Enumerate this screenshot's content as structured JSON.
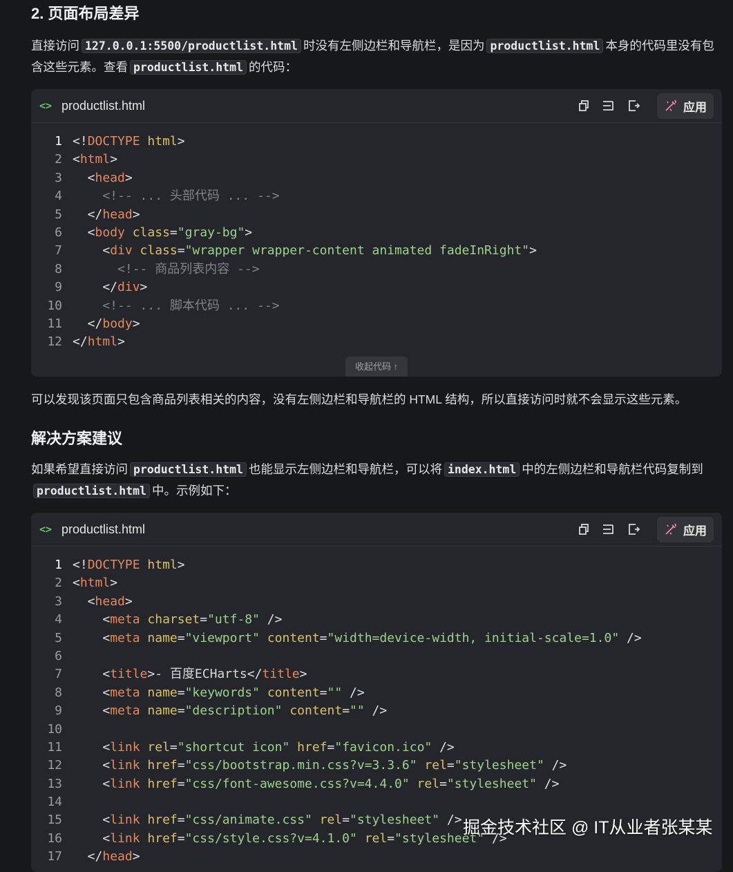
{
  "section_title": "2. 页面布局差异",
  "para1": [
    {
      "t": "text",
      "v": "直接访问"
    },
    {
      "t": "code",
      "v": "127.0.0.1:5500/productlist.html"
    },
    {
      "t": "text",
      "v": "时没有左侧边栏和导航栏，是因为"
    },
    {
      "t": "code",
      "v": "productlist.html"
    },
    {
      "t": "text",
      "v": "本身的代码里没有包含这些元素。查看"
    },
    {
      "t": "code",
      "v": "productlist.html"
    },
    {
      "t": "text",
      "v": "的代码："
    }
  ],
  "block1": {
    "file_icon": "<>",
    "filename": "productlist.html",
    "apply_label": "应用",
    "collapse_label": "收起代码 ↑",
    "lines": [
      [
        [
          "p",
          "<!"
        ],
        [
          "t",
          "DOCTYPE"
        ],
        [
          "p",
          " "
        ],
        [
          "a",
          "html"
        ],
        [
          "p",
          ">"
        ]
      ],
      [
        [
          "p",
          "<"
        ],
        [
          "t",
          "html"
        ],
        [
          "p",
          ">"
        ]
      ],
      [
        [
          "p",
          "  <"
        ],
        [
          "t",
          "head"
        ],
        [
          "p",
          ">"
        ]
      ],
      [
        [
          "cm",
          "    <!-- ... 头部代码 ... -->"
        ]
      ],
      [
        [
          "p",
          "  </"
        ],
        [
          "t",
          "head"
        ],
        [
          "p",
          ">"
        ]
      ],
      [
        [
          "p",
          "  <"
        ],
        [
          "t",
          "body"
        ],
        [
          "p",
          " "
        ],
        [
          "a",
          "class"
        ],
        [
          "p",
          "="
        ],
        [
          "s",
          "\"gray-bg\""
        ],
        [
          "p",
          ">"
        ]
      ],
      [
        [
          "p",
          "    <"
        ],
        [
          "t",
          "div"
        ],
        [
          "p",
          " "
        ],
        [
          "a",
          "class"
        ],
        [
          "p",
          "="
        ],
        [
          "s",
          "\"wrapper wrapper-content animated fadeInRight\""
        ],
        [
          "p",
          ">"
        ]
      ],
      [
        [
          "cm",
          "      <!-- 商品列表内容 -->"
        ]
      ],
      [
        [
          "p",
          "    </"
        ],
        [
          "t",
          "div"
        ],
        [
          "p",
          ">"
        ]
      ],
      [
        [
          "cm",
          "    <!-- ... 脚本代码 ... -->"
        ]
      ],
      [
        [
          "p",
          "  </"
        ],
        [
          "t",
          "body"
        ],
        [
          "p",
          ">"
        ]
      ],
      [
        [
          "p",
          "</"
        ],
        [
          "t",
          "html"
        ],
        [
          "p",
          ">"
        ]
      ]
    ]
  },
  "para2": "可以发现该页面只包含商品列表相关的内容，没有左侧边栏和导航栏的 HTML 结构，所以直接访问时就不会显示这些元素。",
  "section2_title": "解决方案建议",
  "para3": [
    {
      "t": "text",
      "v": "如果希望直接访问"
    },
    {
      "t": "code",
      "v": "productlist.html"
    },
    {
      "t": "text",
      "v": "也能显示左侧边栏和导航栏，可以将"
    },
    {
      "t": "code",
      "v": "index.html"
    },
    {
      "t": "text",
      "v": "中的左侧边栏和导航栏代码复制到"
    },
    {
      "t": "code",
      "v": "productlist.html"
    },
    {
      "t": "text",
      "v": "中。示例如下："
    }
  ],
  "block2": {
    "file_icon": "<>",
    "filename": "productlist.html",
    "apply_label": "应用",
    "lines": [
      [
        [
          "p",
          "<!"
        ],
        [
          "t",
          "DOCTYPE"
        ],
        [
          "p",
          " "
        ],
        [
          "a",
          "html"
        ],
        [
          "p",
          ">"
        ]
      ],
      [
        [
          "p",
          "<"
        ],
        [
          "t",
          "html"
        ],
        [
          "p",
          ">"
        ]
      ],
      [
        [
          "p",
          "  <"
        ],
        [
          "t",
          "head"
        ],
        [
          "p",
          ">"
        ]
      ],
      [
        [
          "p",
          "    <"
        ],
        [
          "t",
          "meta"
        ],
        [
          "p",
          " "
        ],
        [
          "a",
          "charset"
        ],
        [
          "p",
          "="
        ],
        [
          "s",
          "\"utf-8\""
        ],
        [
          "p",
          " />"
        ]
      ],
      [
        [
          "p",
          "    <"
        ],
        [
          "t",
          "meta"
        ],
        [
          "p",
          " "
        ],
        [
          "a",
          "name"
        ],
        [
          "p",
          "="
        ],
        [
          "s",
          "\"viewport\""
        ],
        [
          "p",
          " "
        ],
        [
          "a",
          "content"
        ],
        [
          "p",
          "="
        ],
        [
          "s",
          "\"width=device-width, initial-scale=1.0\""
        ],
        [
          "p",
          " />"
        ]
      ],
      [],
      [
        [
          "p",
          "    <"
        ],
        [
          "t",
          "title"
        ],
        [
          "p",
          ">"
        ],
        [
          "tx",
          "- 百度ECHarts"
        ],
        [
          "p",
          "</"
        ],
        [
          "t",
          "title"
        ],
        [
          "p",
          ">"
        ]
      ],
      [
        [
          "p",
          "    <"
        ],
        [
          "t",
          "meta"
        ],
        [
          "p",
          " "
        ],
        [
          "a",
          "name"
        ],
        [
          "p",
          "="
        ],
        [
          "s",
          "\"keywords\""
        ],
        [
          "p",
          " "
        ],
        [
          "a",
          "content"
        ],
        [
          "p",
          "="
        ],
        [
          "s",
          "\"\""
        ],
        [
          "p",
          " />"
        ]
      ],
      [
        [
          "p",
          "    <"
        ],
        [
          "t",
          "meta"
        ],
        [
          "p",
          " "
        ],
        [
          "a",
          "name"
        ],
        [
          "p",
          "="
        ],
        [
          "s",
          "\"description\""
        ],
        [
          "p",
          " "
        ],
        [
          "a",
          "content"
        ],
        [
          "p",
          "="
        ],
        [
          "s",
          "\"\""
        ],
        [
          "p",
          " />"
        ]
      ],
      [],
      [
        [
          "p",
          "    <"
        ],
        [
          "t",
          "link"
        ],
        [
          "p",
          " "
        ],
        [
          "a",
          "rel"
        ],
        [
          "p",
          "="
        ],
        [
          "s",
          "\"shortcut icon\""
        ],
        [
          "p",
          " "
        ],
        [
          "a",
          "href"
        ],
        [
          "p",
          "="
        ],
        [
          "s",
          "\"favicon.ico\""
        ],
        [
          "p",
          " />"
        ]
      ],
      [
        [
          "p",
          "    <"
        ],
        [
          "t",
          "link"
        ],
        [
          "p",
          " "
        ],
        [
          "a",
          "href"
        ],
        [
          "p",
          "="
        ],
        [
          "s",
          "\"css/bootstrap.min.css?v=3.3.6\""
        ],
        [
          "p",
          " "
        ],
        [
          "a",
          "rel"
        ],
        [
          "p",
          "="
        ],
        [
          "s",
          "\"stylesheet\""
        ],
        [
          "p",
          " />"
        ]
      ],
      [
        [
          "p",
          "    <"
        ],
        [
          "t",
          "link"
        ],
        [
          "p",
          " "
        ],
        [
          "a",
          "href"
        ],
        [
          "p",
          "="
        ],
        [
          "s",
          "\"css/font-awesome.css?v=4.4.0\""
        ],
        [
          "p",
          " "
        ],
        [
          "a",
          "rel"
        ],
        [
          "p",
          "="
        ],
        [
          "s",
          "\"stylesheet\""
        ],
        [
          "p",
          " />"
        ]
      ],
      [],
      [
        [
          "p",
          "    <"
        ],
        [
          "t",
          "link"
        ],
        [
          "p",
          " "
        ],
        [
          "a",
          "href"
        ],
        [
          "p",
          "="
        ],
        [
          "s",
          "\"css/animate.css\""
        ],
        [
          "p",
          " "
        ],
        [
          "a",
          "rel"
        ],
        [
          "p",
          "="
        ],
        [
          "s",
          "\"stylesheet\""
        ],
        [
          "p",
          " />"
        ]
      ],
      [
        [
          "p",
          "    <"
        ],
        [
          "t",
          "link"
        ],
        [
          "p",
          " "
        ],
        [
          "a",
          "href"
        ],
        [
          "p",
          "="
        ],
        [
          "s",
          "\"css/style.css?v=4.1.0\""
        ],
        [
          "p",
          " "
        ],
        [
          "a",
          "rel"
        ],
        [
          "p",
          "="
        ],
        [
          "s",
          "\"stylesheet\""
        ],
        [
          "p",
          " />"
        ]
      ],
      [
        [
          "p",
          "  </"
        ],
        [
          "t",
          "head"
        ],
        [
          "p",
          ">"
        ]
      ]
    ]
  },
  "watermark": "掘金技术社区 @ IT从业者张某某"
}
